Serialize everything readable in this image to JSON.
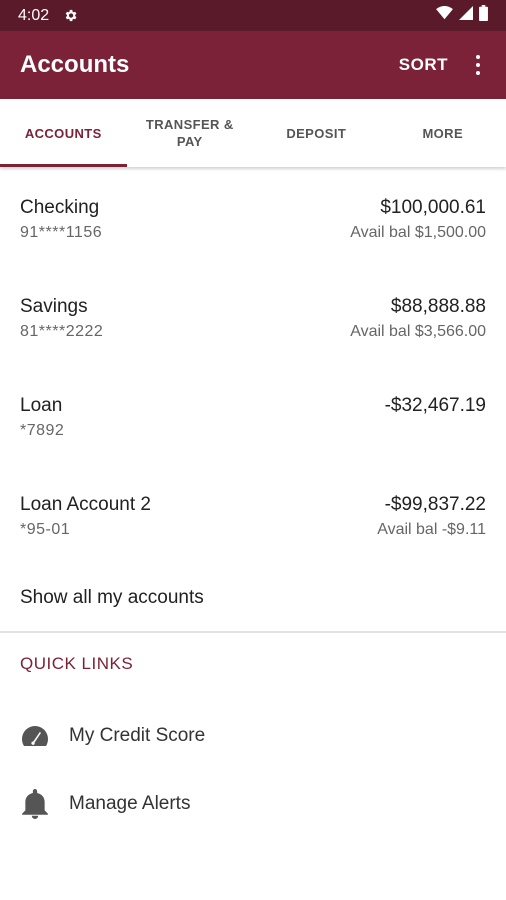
{
  "status_bar": {
    "time": "4:02",
    "icons": [
      "gear-icon",
      "wifi-icon",
      "signal-icon",
      "battery-icon"
    ]
  },
  "app_bar": {
    "title": "Accounts",
    "sort_label": "SORT",
    "more_icon": "more-vert-icon"
  },
  "tabs": [
    {
      "label": "ACCOUNTS",
      "active": true
    },
    {
      "label": "TRANSFER & PAY",
      "active": false
    },
    {
      "label": "DEPOSIT",
      "active": false
    },
    {
      "label": "MORE",
      "active": false
    }
  ],
  "accounts": [
    {
      "name": "Checking",
      "number": "91****1156",
      "balance": "$100,000.61",
      "available": "Avail bal $1,500.00"
    },
    {
      "name": "Savings",
      "number": "81****2222",
      "balance": "$88,888.88",
      "available": "Avail bal $3,566.00"
    },
    {
      "name": "Loan",
      "number": "*7892",
      "balance": "-$32,467.19",
      "available": ""
    },
    {
      "name": "Loan Account 2",
      "number": "*95-01",
      "balance": "-$99,837.22",
      "available": "Avail bal -$9.11"
    }
  ],
  "show_all_label": "Show all my accounts",
  "quick_links": {
    "title": "QUICK LINKS",
    "items": [
      {
        "label": "My Credit Score",
        "icon": "gauge-icon"
      },
      {
        "label": "Manage Alerts",
        "icon": "bell-icon"
      }
    ]
  },
  "colors": {
    "primary": "#7b2238",
    "status_bar": "#5a1a2a",
    "text": "#212121",
    "secondary_text": "#666666"
  }
}
